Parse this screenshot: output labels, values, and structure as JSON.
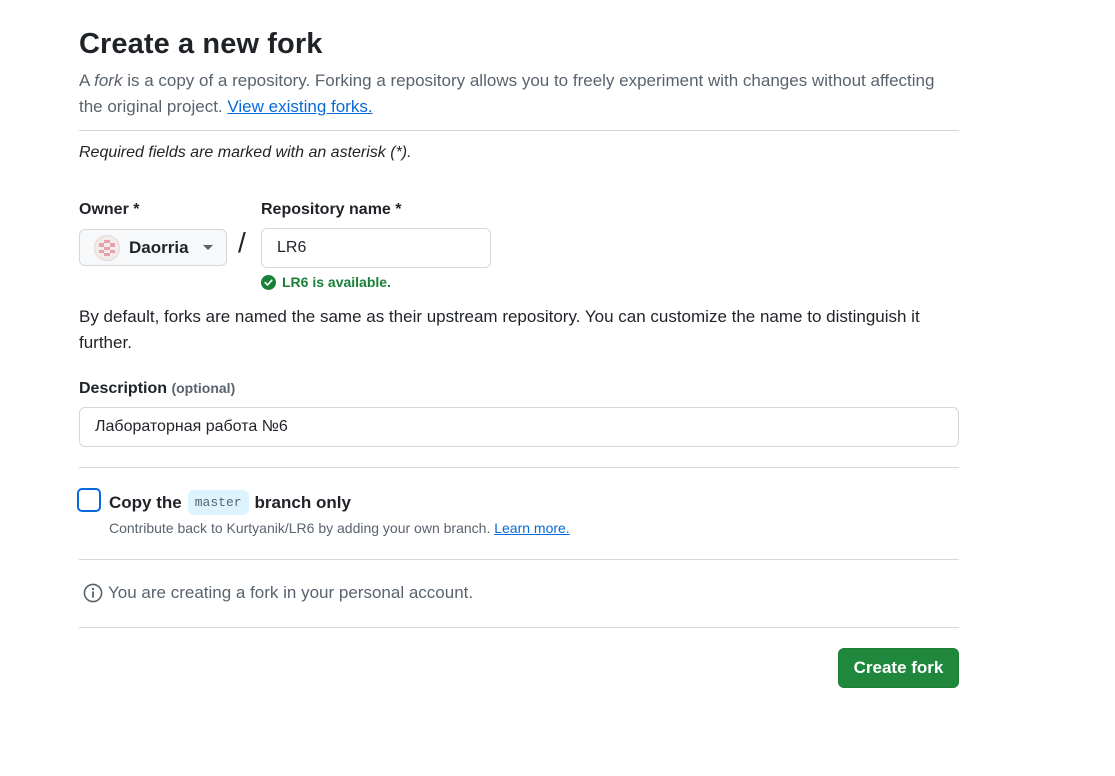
{
  "page": {
    "title": "Create a new fork",
    "lead_prefix": "A ",
    "lead_fork_word": "fork",
    "lead_text": " is a copy of a repository. Forking a repository allows you to freely experiment with changes without affecting the original project. ",
    "lead_link": "View existing forks.",
    "required_note": "Required fields are marked with an asterisk (*)."
  },
  "owner": {
    "label": "Owner *",
    "selected": "Daorria"
  },
  "repo": {
    "label": "Repository name *",
    "value": "LR6",
    "availability": "LR6 is available."
  },
  "help_text": "By default, forks are named the same as their upstream repository. You can customize the name to distinguish it further.",
  "description": {
    "label": "Description",
    "optional": "(optional)",
    "value": "Лабораторная работа №6"
  },
  "copy_branch": {
    "prefix": "Copy the",
    "branch": "master",
    "suffix": "branch only",
    "checked": false,
    "sub_text": "Contribute back to Kurtyanik/LR6 by adding your own branch. ",
    "sub_link": "Learn more."
  },
  "info_text": "You are creating a fork in your personal account.",
  "submit_label": "Create fork",
  "colors": {
    "primary_button": "#1f883d",
    "link": "#0969da",
    "success": "#1a7f37",
    "branch_badge_bg": "#ddf4ff"
  }
}
